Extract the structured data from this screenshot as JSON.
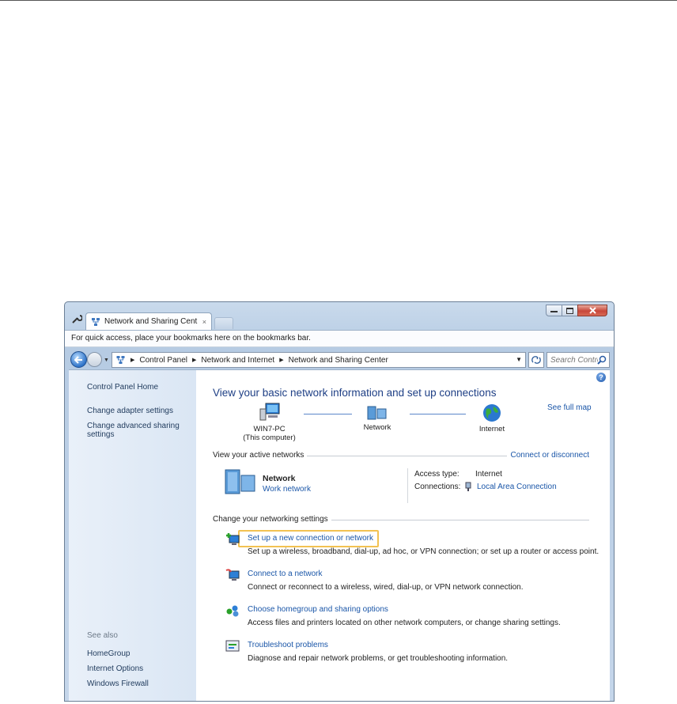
{
  "tab": {
    "title": "Network and Sharing Cent",
    "close": "×"
  },
  "bookmarks_bar": {
    "text": "For quick access, place your bookmarks here on the bookmarks bar."
  },
  "address_bar": {
    "crumbs": [
      "Control Panel",
      "Network and Internet",
      "Network and Sharing Center"
    ]
  },
  "search": {
    "placeholder": "Search Control..."
  },
  "sidebar": {
    "items": [
      {
        "label": "Control Panel Home"
      },
      {
        "label": "Change adapter settings"
      },
      {
        "label": "Change advanced sharing settings"
      }
    ],
    "see_also_label": "See also",
    "see_also": [
      {
        "label": "HomeGroup"
      },
      {
        "label": "Internet Options"
      },
      {
        "label": "Windows Firewall"
      }
    ]
  },
  "main": {
    "title": "View your basic network information and set up connections",
    "see_full_map": "See full map",
    "map": {
      "computer_name": "WIN7-PC",
      "computer_sub": "(This computer)",
      "network": "Network",
      "internet": "Internet"
    },
    "active_networks": {
      "heading": "View your active networks",
      "connect_link": "Connect or disconnect",
      "network_name": "Network",
      "network_type": "Work network",
      "access_type_label": "Access type:",
      "access_type_value": "Internet",
      "connections_label": "Connections:",
      "connections_value": "Local Area Connection"
    },
    "settings": {
      "heading": "Change your networking settings",
      "tasks": [
        {
          "title": "Set up a new connection or network",
          "desc": "Set up a wireless, broadband, dial-up, ad hoc, or VPN connection; or set up a router or access point."
        },
        {
          "title": "Connect to a network",
          "desc": "Connect or reconnect to a wireless, wired, dial-up, or VPN network connection."
        },
        {
          "title": "Choose homegroup and sharing options",
          "desc": "Access files and printers located on other network computers, or change sharing settings."
        },
        {
          "title": "Troubleshoot problems",
          "desc": "Diagnose and repair network problems, or get troubleshooting information."
        }
      ]
    }
  },
  "colors": {
    "link": "#1a56a8",
    "title": "#1e3f85",
    "highlight": "#f2c252"
  }
}
